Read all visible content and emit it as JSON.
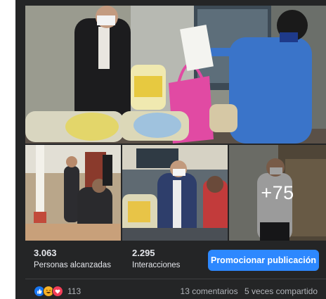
{
  "photos": {
    "main_alt": "Food bag delivery",
    "more_count": "+75"
  },
  "stats": [
    {
      "value": "3.063",
      "label": "Personas alcanzadas"
    },
    {
      "value": "2.295",
      "label": "Interacciones"
    }
  ],
  "promote_label": "Promocionar publicación",
  "reactions": {
    "icons": [
      "like-icon",
      "haha-icon",
      "love-icon"
    ],
    "count": "113"
  },
  "comments": "13 comentarios",
  "shares": "5 veces compartido",
  "colors": {
    "card_bg": "#242526",
    "button": "#2d88ff",
    "secondary_text": "#b0b3b8"
  }
}
